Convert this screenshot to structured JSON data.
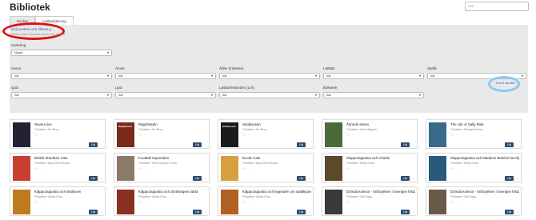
{
  "page_title": "Bibliotek",
  "search": {
    "placeholder": "Sök"
  },
  "tabs": [
    "Böcker",
    "Ledtyckläsning"
  ],
  "filters": {
    "toggle_label": "Dölj Sortera och filtrera",
    "toggle_hint": "Filtrera bland tusentals böcker och tjänster",
    "sortering": {
      "label": "Sortering",
      "value": "Nyast"
    },
    "fields": [
      {
        "label": "Genre",
        "value": "Allt"
      },
      {
        "label": "Ämne",
        "value": "Allt"
      },
      {
        "label": "Ålder (intresse)",
        "value": "Allt"
      },
      {
        "label": "Lättläst",
        "value": "Allt"
      },
      {
        "label": "Språk",
        "value": "Allt"
      },
      {
        "label": "Quiz",
        "value": "Allt"
      },
      {
        "label": "Ljud",
        "value": "Allt"
      },
      {
        "label": "Läsbarhetsindex (LIX)",
        "value": "Allt"
      },
      {
        "label": "Bokserie",
        "value": "Allt"
      }
    ],
    "reset_label": "Ta bort alla filter"
  },
  "books": [
    {
      "title": "Nevers live",
      "author": "Författare: Per Berg",
      "cover_color": "#222233",
      "cover_text": ""
    },
    {
      "title": "Räpphästen",
      "author": "Författare: Per Berg",
      "cover_color": "#7a2a1a",
      "cover_text": "Räpphästen"
    },
    {
      "title": "Skolbussen",
      "author": "Författare: Per Berg",
      "cover_color": "#1b1b1b",
      "cover_text": "Skolbussen"
    },
    {
      "title": "Åttonde steien",
      "author": "Författare: Greta Sjögren",
      "cover_color": "#4a6a3a",
      "cover_text": ""
    },
    {
      "title": "The Life of Sally Ride",
      "author": "Författare: Elizabeth Raum",
      "cover_color": "#3a6a8a",
      "cover_text": ""
    },
    {
      "title": "British Shorthair Cats",
      "author": "Författare: Mary Ellen Klukow",
      "cover_color": "#c84030",
      "cover_text": ""
    },
    {
      "title": "Football Superstars",
      "author": "Författare: Teddi Clausen Greve",
      "cover_color": "#8a7a6a",
      "cover_text": ""
    },
    {
      "title": "Exotic Cats",
      "author": "Författare: Mary Ellen Klukow",
      "cover_color": "#d6a040",
      "cover_text": ""
    },
    {
      "title": "Klapporappaina och Charlie",
      "author": "Författare: Stefan Ross",
      "cover_color": "#5a4a2a",
      "cover_text": ""
    },
    {
      "title": "Klapporappaina och Madame Bofvins hemlighet",
      "author": "Författare: Stefan Ross",
      "cover_color": "#2a5a7a",
      "cover_text": ""
    },
    {
      "title": "Klapporappaina och skollyxen",
      "author": "Författare: Stefan Ross",
      "cover_color": "#c07a20",
      "cover_text": ""
    },
    {
      "title": "Klapporappaina och drottningens tärta",
      "author": "Författare: Stefan Ross",
      "cover_color": "#8a3020",
      "cover_text": ""
    },
    {
      "title": "Klapporappaina och legenden om spökkjuven",
      "author": "Författare: Stefan Ross",
      "cover_color": "#b06020",
      "cover_text": ""
    },
    {
      "title": "Dömda kvinnor - förbrytelser i Sveriges historia",
      "author": "Författare: Olle Hägg",
      "cover_color": "#3a3a3a",
      "cover_text": ""
    },
    {
      "title": "Dömda kvinnor - förbrytelser i Sveriges historia",
      "author": "Författare: Olle Hägg",
      "cover_color": "#6a5a4a",
      "cover_text": ""
    }
  ],
  "book_actions": {
    "read_label": "Läs",
    "more_label": "⌄"
  },
  "rating_display": "☆ --"
}
